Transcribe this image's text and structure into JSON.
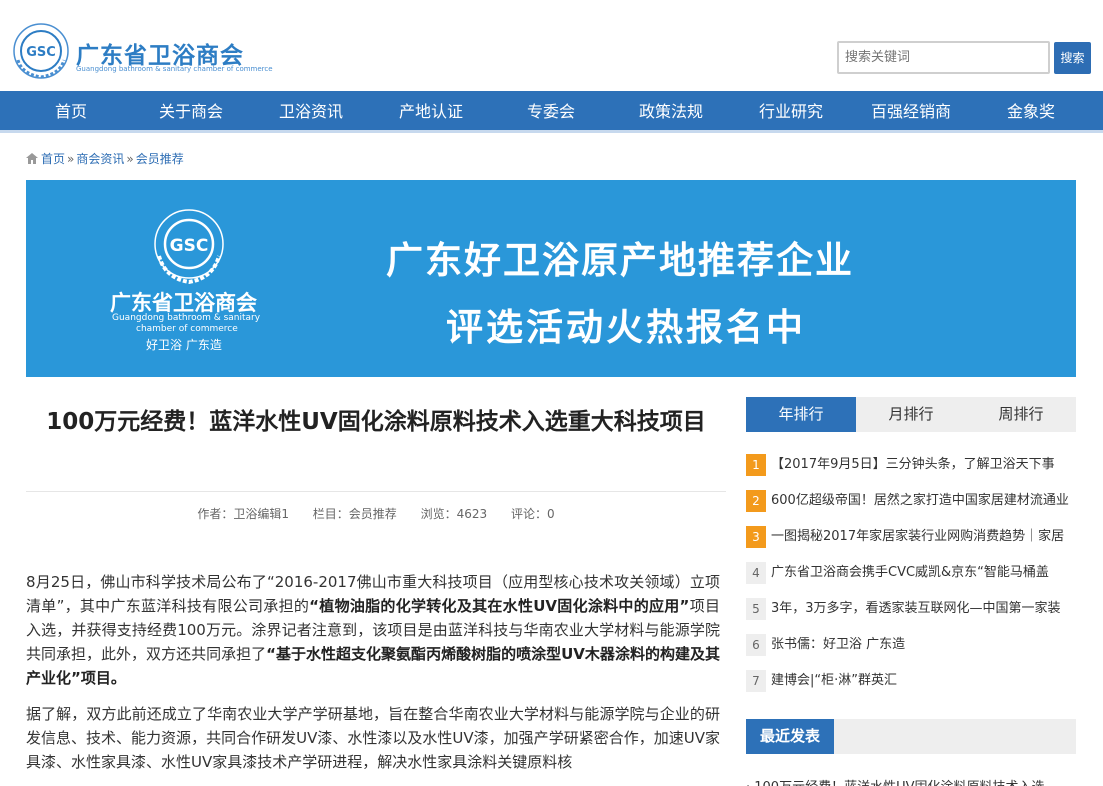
{
  "header": {
    "logo_title": "广东省卫浴商会",
    "logo_subtitle": "Guangdong bathroom & sanitary chamber of commerce",
    "logo_emblem_text": "GSC",
    "search_placeholder": "搜索关键词",
    "search_button": "搜索"
  },
  "nav": {
    "items": [
      "首页",
      "关于商会",
      "卫浴资讯",
      "产地认证",
      "专委会",
      "政策法规",
      "行业研究",
      "百强经销商",
      "金象奖"
    ]
  },
  "breadcrumb": {
    "home": "首页",
    "separator": "»",
    "level1": "商会资讯",
    "level2": "会员推荐"
  },
  "banner": {
    "emblem_text": "GSC",
    "logo_title": "广东省卫浴商会",
    "logo_sub1": "Guangdong bathroom & sanitary",
    "logo_sub2": "chamber of commerce",
    "logo_slogan": "好卫浴  广东造",
    "line1": "广东好卫浴原产地推荐企业",
    "line2": "评选活动火热报名中"
  },
  "article": {
    "title": "100万元经费！蓝洋水性UV固化涂料原料技术入选重大科技项目",
    "meta_author": "作者：卫浴编辑1",
    "meta_column": "栏目：会员推荐",
    "meta_views": "浏览：4623",
    "meta_comments": "评论：0",
    "p1_a": "8月25日，佛山市科学技术局公布了“2016-2017佛山市重大科技项目（应用型核心技术攻关领域）立项清单”，其中广东蓝洋科技有限公司承担的",
    "p1_b": "“植物油脂的化学转化及其在水性UV固化涂料中的应用”",
    "p1_c": "项目入选，并获得支持经费100万元。涂界记者注意到，该项目是由蓝洋科技与华南农业大学材料与能源学院共同承担，此外，双方还共同承担了",
    "p1_d": "“基于水性超支化聚氨酯丙烯酸树脂的喷涂型UV木器涂料的构建及其产业化”",
    "p1_e": "项目。",
    "p2": "据了解，双方此前还成立了华南农业大学产学研基地，旨在整合华南农业大学材料与能源学院与企业的研发信息、技术、能力资源，共同合作研发UV漆、水性漆以及水性UV漆，加强产学研紧密合作，加速UV家具漆、水性家具漆、水性UV家具漆技术产学研进程，解决水性家具涂料关键原料核"
  },
  "rank": {
    "tabs": [
      "年排行",
      "月排行",
      "周排行"
    ],
    "items": [
      {
        "num": "1",
        "text": "【2017年9月5日】三分钟头条，了解卫浴天下事"
      },
      {
        "num": "2",
        "text": "600亿超级帝国！居然之家打造中国家居建材流通业"
      },
      {
        "num": "3",
        "text": "一图揭秘2017年家居家装行业网购消费趋势｜家居"
      },
      {
        "num": "4",
        "text": "广东省卫浴商会携手CVC威凯&京东“智能马桶盖"
      },
      {
        "num": "5",
        "text": "3年，3万多字，看透家装互联网化—中国第一家装"
      },
      {
        "num": "6",
        "text": "张书儒：好卫浴 广东造"
      },
      {
        "num": "7",
        "text": "建博会|“柜·淋”群英汇"
      }
    ]
  },
  "recent": {
    "title": "最近发表",
    "first_item": "· 100万元经费！蓝洋水性UV固化涂料原料技术入选"
  },
  "colors": {
    "brand_blue": "#2d71b8",
    "banner_blue": "#2a97d9",
    "hot_orange": "#f39a1c"
  }
}
